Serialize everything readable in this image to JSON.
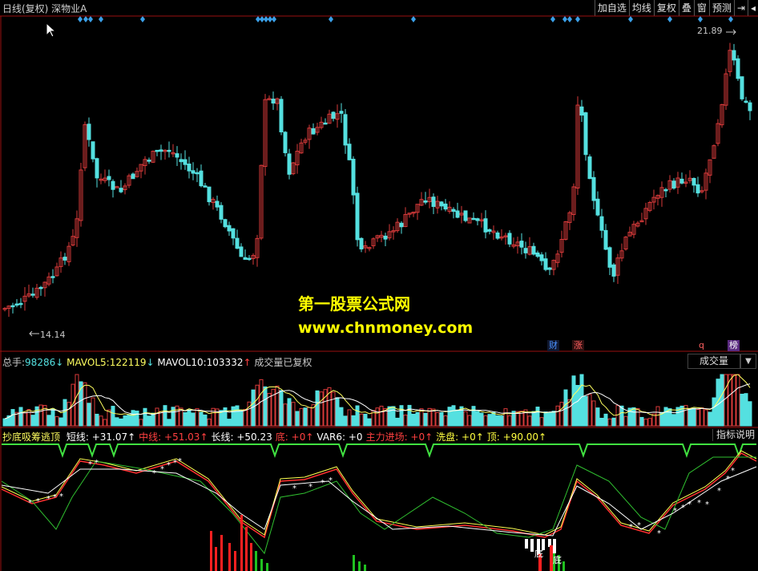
{
  "title": "日线(复权) 深物业A",
  "toolbar": [
    "加自选",
    "均线",
    "复权",
    "叠",
    "窗",
    "预测",
    "⇥",
    "◂"
  ],
  "price": {
    "high_label": "21.89",
    "low_label": "14.14",
    "badges": [
      "财",
      "涨",
      "q",
      "榜"
    ],
    "colors": {
      "up": "#d83a3a",
      "down": "#54e0e0",
      "marker": "#3aa0e8"
    }
  },
  "watermark": {
    "line1": "第一股票公式网",
    "line2": "www.chnmoney.com"
  },
  "volume": {
    "label": "总手:",
    "total": "98286",
    "mavol5_label": "MAVOL5:",
    "mavol5": "122119",
    "mavol10_label": "MAVOL10:",
    "mavol10": "103332",
    "note": "成交量已复权",
    "selector": "成交量",
    "dropdown": "▼"
  },
  "indicator": {
    "name": "抄底吸筹逃顶",
    "items": [
      {
        "label": "短线:",
        "value": "+31.07",
        "color": "#ffffff"
      },
      {
        "label": "中线:",
        "value": "+51.03",
        "color": "#ff4040"
      },
      {
        "label": "长线:",
        "value": "+50.23",
        "color": "#ffffff"
      },
      {
        "label": "底:",
        "value": "+0",
        "color": "#ff4040"
      },
      {
        "label": "VAR6:",
        "value": "+0",
        "color": "#ffffff"
      },
      {
        "label": "主力进场:",
        "value": "+0",
        "color": "#ff4040"
      },
      {
        "label": "洗盘:",
        "value": "+0",
        "color": "#ffff40"
      },
      {
        "label": "顶:",
        "value": "+90.00",
        "color": "#ffff40"
      }
    ],
    "button": "指标说明",
    "bottom_labels": [
      "底",
      "底"
    ]
  }
}
